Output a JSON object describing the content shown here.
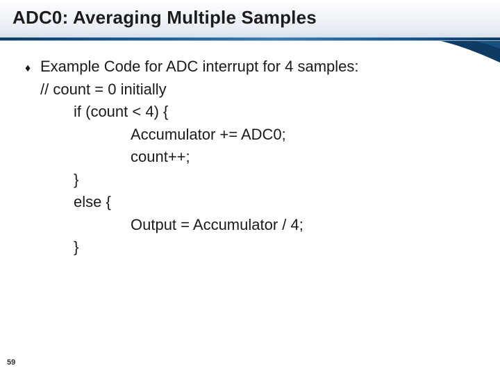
{
  "slide": {
    "title": "ADC0: Averaging Multiple Samples",
    "bullet": "Example Code for ADC interrupt for 4 samples:",
    "code": {
      "l1": "// count = 0 initially",
      "l2": "if (count < 4) {",
      "l3": "Accumulator += ADC0;",
      "l4": "count++;",
      "l5": "}",
      "l6": "else {",
      "l7": "Output = Accumulator / 4;",
      "l8": "}"
    },
    "page_number": "59"
  }
}
